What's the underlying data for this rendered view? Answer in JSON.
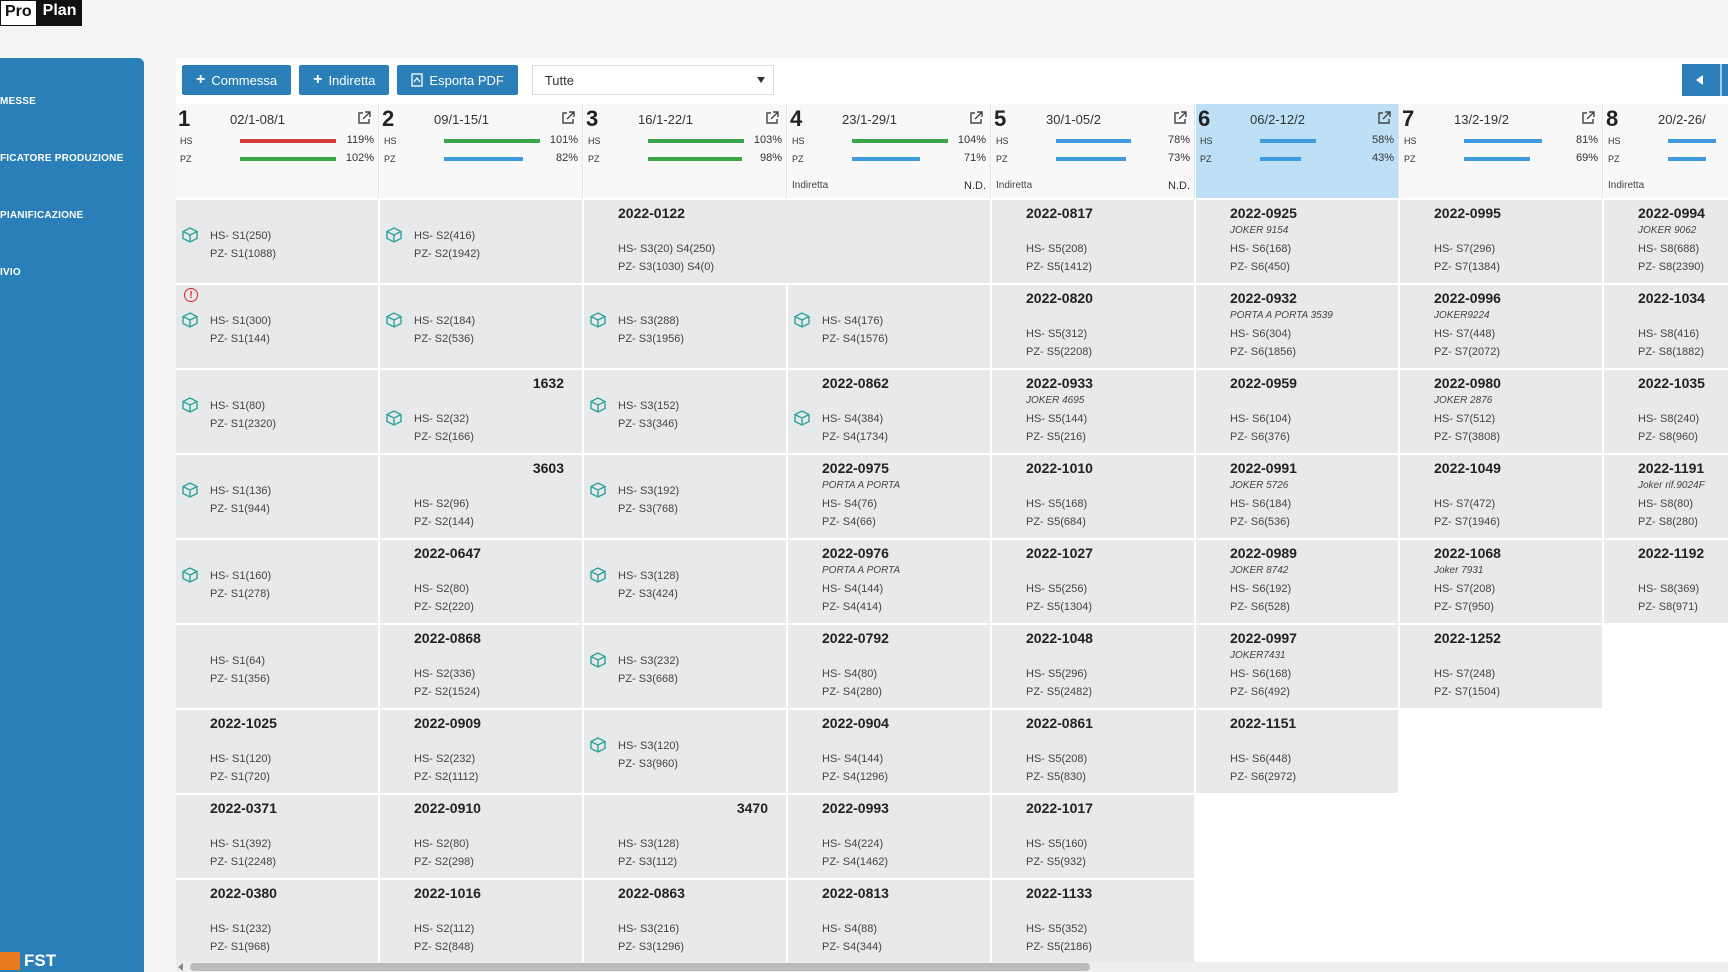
{
  "logo": {
    "part1": "Pro",
    "part2": "Plan"
  },
  "sidebar": {
    "items": [
      {
        "label": "MESSE"
      },
      {
        "label": "FICATORE PRODUZIONE"
      },
      {
        "label": "PIANIFICAZIONE"
      },
      {
        "label": "IVIO"
      }
    ],
    "footer": "FST"
  },
  "toolbar": {
    "commessa_label": "Commessa",
    "indiretta_label": "Indiretta",
    "esporta_label": "Esporta PDF",
    "filter_value": "Tutte"
  },
  "colors": {
    "accent": "#2a7fb8",
    "red": "#d43a3a",
    "green": "#3aa84a",
    "blue": "#3f9ae0",
    "highlight": "#bde0f6"
  },
  "weeks": [
    {
      "num": "1",
      "dates": "02/1-08/1",
      "hs_pct": "119%",
      "pz_pct": "102%",
      "hs_color": "red",
      "pz_color": "green",
      "hs_fill": 1.0,
      "pz_fill": 1.0,
      "note": "",
      "nd": ""
    },
    {
      "num": "2",
      "dates": "09/1-15/1",
      "hs_pct": "101%",
      "pz_pct": "82%",
      "hs_color": "green",
      "pz_color": "blue",
      "hs_fill": 1.0,
      "pz_fill": 0.82,
      "note": "",
      "nd": ""
    },
    {
      "num": "3",
      "dates": "16/1-22/1",
      "hs_pct": "103%",
      "pz_pct": "98%",
      "hs_color": "green",
      "pz_color": "green",
      "hs_fill": 1.0,
      "pz_fill": 0.98,
      "note": "",
      "nd": ""
    },
    {
      "num": "4",
      "dates": "23/1-29/1",
      "hs_pct": "104%",
      "pz_pct": "71%",
      "hs_color": "green",
      "pz_color": "blue",
      "hs_fill": 1.0,
      "pz_fill": 0.71,
      "note": "Indiretta",
      "nd": "N.D."
    },
    {
      "num": "5",
      "dates": "30/1-05/2",
      "hs_pct": "78%",
      "pz_pct": "73%",
      "hs_color": "blue",
      "pz_color": "blue",
      "hs_fill": 0.78,
      "pz_fill": 0.73,
      "note": "Indiretta",
      "nd": "N.D."
    },
    {
      "num": "6",
      "dates": "06/2-12/2",
      "hs_pct": "58%",
      "pz_pct": "43%",
      "hs_color": "blue",
      "pz_color": "blue",
      "hs_fill": 0.58,
      "pz_fill": 0.43,
      "note": "",
      "nd": "",
      "highlight": true
    },
    {
      "num": "7",
      "dates": "13/2-19/2",
      "hs_pct": "81%",
      "pz_pct": "69%",
      "hs_color": "blue",
      "pz_color": "blue",
      "hs_fill": 0.81,
      "pz_fill": 0.69,
      "note": "",
      "nd": ""
    },
    {
      "num": "8",
      "dates": "20/2-26/",
      "hs_pct": "",
      "pz_pct": "",
      "hs_color": "blue",
      "pz_color": "blue",
      "hs_fill": 0.5,
      "pz_fill": 0.4,
      "note": "Indiretta",
      "nd": ""
    }
  ],
  "columns": [
    [
      {
        "title": "",
        "sub": "",
        "hs": "HS- S1(250)",
        "pz": "PZ- S1(1088)",
        "box": true
      },
      {
        "title": "",
        "sub": "",
        "hs": "HS- S1(300)",
        "pz": "PZ- S1(144)",
        "box": true,
        "warn": true
      },
      {
        "title": "",
        "sub": "",
        "hs": "HS- S1(80)",
        "pz": "PZ- S1(2320)",
        "box": true
      },
      {
        "title": "",
        "sub": "",
        "hs": "HS- S1(136)",
        "pz": "PZ- S1(944)",
        "box": true
      },
      {
        "title": "",
        "sub": "",
        "hs": "HS- S1(160)",
        "pz": "PZ- S1(278)",
        "box": true
      },
      {
        "title": "",
        "sub": "",
        "hs": "HS- S1(64)",
        "pz": "PZ- S1(356)"
      },
      {
        "title": "2022-1025",
        "sub": "",
        "hs": "HS- S1(120)",
        "pz": "PZ- S1(720)"
      },
      {
        "title": "2022-0371",
        "sub": "",
        "hs": "HS- S1(392)",
        "pz": "PZ- S1(2248)"
      },
      {
        "title": "2022-0380",
        "sub": "",
        "hs": "HS- S1(232)",
        "pz": "PZ- S1(968)"
      }
    ],
    [
      {
        "title": "",
        "sub": "",
        "hs": "HS- S2(416)",
        "pz": "PZ- S2(1942)",
        "box": true
      },
      {
        "title": "",
        "sub": "",
        "hs": "HS- S2(184)",
        "pz": "PZ- S2(536)",
        "box": true
      },
      {
        "title": "1632",
        "sub": "",
        "hs": "HS- S2(32)",
        "pz": "PZ- S2(166)",
        "box": true,
        "title_right": true
      },
      {
        "title": "3603",
        "sub": "",
        "hs": "HS- S2(96)",
        "pz": "PZ- S2(144)",
        "title_right": true
      },
      {
        "title": "2022-0647",
        "sub": "",
        "hs": "HS- S2(80)",
        "pz": "PZ- S2(220)"
      },
      {
        "title": "2022-0868",
        "sub": "",
        "hs": "HS- S2(336)",
        "pz": "PZ- S2(1524)"
      },
      {
        "title": "2022-0909",
        "sub": "",
        "hs": "HS- S2(232)",
        "pz": "PZ- S2(1112)"
      },
      {
        "title": "2022-0910",
        "sub": "",
        "hs": "HS- S2(80)",
        "pz": "PZ- S2(298)"
      },
      {
        "title": "2022-1016",
        "sub": "",
        "hs": "HS- S2(112)",
        "pz": "PZ- S2(848)"
      }
    ],
    [
      {
        "title": "2022-0122",
        "sub": "",
        "hs": "HS- S3(20) S4(250)",
        "pz": "PZ- S3(1030) S4(0)",
        "span": 2
      },
      {
        "title": "",
        "sub": "",
        "hs": "HS- S3(288)",
        "pz": "PZ- S3(1956)",
        "box": true
      },
      {
        "title": "",
        "sub": "",
        "hs": "HS- S3(152)",
        "pz": "PZ- S3(346)",
        "box": true
      },
      {
        "title": "",
        "sub": "",
        "hs": "HS- S3(192)",
        "pz": "PZ- S3(768)",
        "box": true
      },
      {
        "title": "",
        "sub": "",
        "hs": "HS- S3(128)",
        "pz": "PZ- S3(424)",
        "box": true
      },
      {
        "title": "",
        "sub": "",
        "hs": "HS- S3(232)",
        "pz": "PZ- S3(668)",
        "box": true
      },
      {
        "title": "",
        "sub": "",
        "hs": "HS- S3(120)",
        "pz": "PZ- S3(960)",
        "box": true
      },
      {
        "title": "3470",
        "sub": "",
        "hs": "HS- S3(128)",
        "pz": "PZ- S3(112)",
        "title_right": true
      },
      {
        "title": "2022-0863",
        "sub": "",
        "hs": "HS- S3(216)",
        "pz": "PZ- S3(1296)"
      }
    ],
    [
      {
        "skip": true
      },
      {
        "title": "",
        "sub": "",
        "hs": "HS- S4(176)",
        "pz": "PZ- S4(1576)",
        "box": true
      },
      {
        "title": "2022-0862",
        "sub": "",
        "hs": "HS- S4(384)",
        "pz": "PZ- S4(1734)",
        "box": true
      },
      {
        "title": "2022-0975",
        "sub": "PORTA A PORTA",
        "hs": "HS- S4(76)",
        "pz": "PZ- S4(66)"
      },
      {
        "title": "2022-0976",
        "sub": "PORTA A PORTA",
        "hs": "HS- S4(144)",
        "pz": "PZ- S4(414)"
      },
      {
        "title": "2022-0792",
        "sub": "",
        "hs": "HS- S4(80)",
        "pz": "PZ- S4(280)"
      },
      {
        "title": "2022-0904",
        "sub": "",
        "hs": "HS- S4(144)",
        "pz": "PZ- S4(1296)"
      },
      {
        "title": "2022-0993",
        "sub": "",
        "hs": "HS- S4(224)",
        "pz": "PZ- S4(1462)"
      },
      {
        "title": "2022-0813",
        "sub": "",
        "hs": "HS- S4(88)",
        "pz": "PZ- S4(344)"
      }
    ],
    [
      {
        "title": "2022-0817",
        "sub": "",
        "hs": "HS- S5(208)",
        "pz": "PZ- S5(1412)"
      },
      {
        "title": "2022-0820",
        "sub": "",
        "hs": "HS- S5(312)",
        "pz": "PZ- S5(2208)"
      },
      {
        "title": "2022-0933",
        "sub": "JOKER 4695",
        "hs": "HS- S5(144)",
        "pz": "PZ- S5(216)"
      },
      {
        "title": "2022-1010",
        "sub": "",
        "hs": "HS- S5(168)",
        "pz": "PZ- S5(684)"
      },
      {
        "title": "2022-1027",
        "sub": "",
        "hs": "HS- S5(256)",
        "pz": "PZ- S5(1304)"
      },
      {
        "title": "2022-1048",
        "sub": "",
        "hs": "HS- S5(296)",
        "pz": "PZ- S5(2482)"
      },
      {
        "title": "2022-0861",
        "sub": "",
        "hs": "HS- S5(208)",
        "pz": "PZ- S5(830)"
      },
      {
        "title": "2022-1017",
        "sub": "",
        "hs": "HS- S5(160)",
        "pz": "PZ- S5(932)"
      },
      {
        "title": "2022-1133",
        "sub": "",
        "hs": "HS- S5(352)",
        "pz": "PZ- S5(2186)"
      }
    ],
    [
      {
        "title": "2022-0925",
        "sub": "JOKER 9154",
        "hs": "HS- S6(168)",
        "pz": "PZ- S6(450)"
      },
      {
        "title": "2022-0932",
        "sub": "PORTA A PORTA 3539",
        "hs": "HS- S6(304)",
        "pz": "PZ- S6(1856)"
      },
      {
        "title": "2022-0959",
        "sub": "",
        "hs": "HS- S6(104)",
        "pz": "PZ- S6(376)"
      },
      {
        "title": "2022-0991",
        "sub": "JOKER 5726",
        "hs": "HS- S6(184)",
        "pz": "PZ- S6(536)"
      },
      {
        "title": "2022-0989",
        "sub": "JOKER 8742",
        "hs": "HS- S6(192)",
        "pz": "PZ- S6(528)"
      },
      {
        "title": "2022-0997",
        "sub": "JOKER7431",
        "hs": "HS- S6(168)",
        "pz": "PZ- S6(492)"
      },
      {
        "title": "2022-1151",
        "sub": "",
        "hs": "HS- S6(448)",
        "pz": "PZ- S6(2972)"
      }
    ],
    [
      {
        "title": "2022-0995",
        "sub": "",
        "hs": "HS- S7(296)",
        "pz": "PZ- S7(1384)"
      },
      {
        "title": "2022-0996",
        "sub": "JOKER9224",
        "hs": "HS- S7(448)",
        "pz": "PZ- S7(2072)"
      },
      {
        "title": "2022-0980",
        "sub": "JOKER 2876",
        "hs": "HS- S7(512)",
        "pz": "PZ- S7(3808)"
      },
      {
        "title": "2022-1049",
        "sub": "",
        "hs": "HS- S7(472)",
        "pz": "PZ- S7(1946)"
      },
      {
        "title": "2022-1068",
        "sub": "Joker 7931",
        "hs": "HS- S7(208)",
        "pz": "PZ- S7(950)"
      },
      {
        "title": "2022-1252",
        "sub": "",
        "hs": "HS- S7(248)",
        "pz": "PZ- S7(1504)"
      }
    ],
    [
      {
        "title": "2022-0994",
        "sub": "JOKER 9062",
        "hs": "HS- S8(688)",
        "pz": "PZ- S8(2390)"
      },
      {
        "title": "2022-1034",
        "sub": "",
        "hs": "HS- S8(416)",
        "pz": "PZ- S8(1882)"
      },
      {
        "title": "2022-1035",
        "sub": "",
        "hs": "HS- S8(240)",
        "pz": "PZ- S8(960)"
      },
      {
        "title": "2022-1191",
        "sub": "Joker rif.9024F",
        "hs": "HS- S8(80)",
        "pz": "PZ- S8(280)"
      },
      {
        "title": "2022-1192",
        "sub": "",
        "hs": "HS- S8(369)",
        "pz": "PZ- S8(971)"
      }
    ]
  ]
}
